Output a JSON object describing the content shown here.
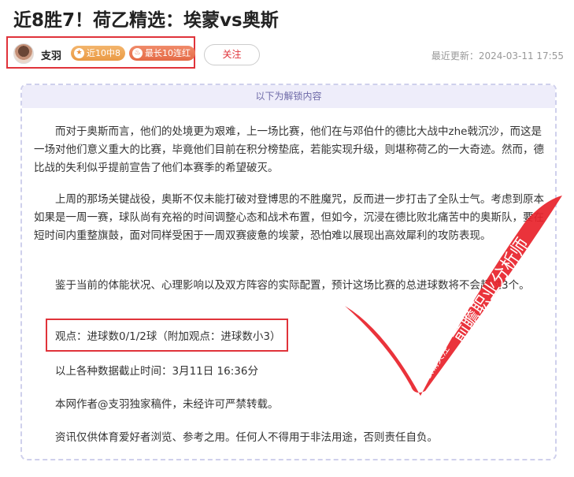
{
  "article": {
    "title": "近8胜7！荷乙精选：埃蒙vs奥斯",
    "author_name": "支羽",
    "badges": [
      {
        "icon": "star-icon",
        "label": "近10中8"
      },
      {
        "icon": "flame-icon",
        "label": "最长10连红"
      }
    ],
    "follow_label": "关注",
    "update_time": "最近更新：2024-03-11 17:55"
  },
  "content": {
    "unlock_banner": "以下为解锁内容",
    "paragraphs": [
      "而对于奥斯而言，他们的处境更为艰难，上一场比赛，他们在与邓伯什的德比大战中zhe戟沉沙，而这是一场对他们意义重大的比赛，毕竟他们目前在积分榜垫底，若能实现升级，则堪称荷乙的一大奇迹。然而，德比战的失利似乎提前宣告了他们本赛季的希望破灭。",
      "上周的那场关键战役，奥斯不仅未能打破对登博思的不胜魔咒，反而进一步打击了全队士气。考虑到原本如果是一周一赛，球队尚有充裕的时间调整心态和战术布置，但如今，沉浸在德比败北痛苦中的奥斯队，要在短时间内重整旗鼓，面对同样受困于一周双赛疲惫的埃蒙，恐怕难以展现出高效犀利的攻防表现。",
      "鉴于当前的体能状况、心理影响以及双方阵容的实际配置，预计这场比赛的总进球数将不会超过3个。"
    ],
    "opinion": "观点：进球数0/1/2球（附加观点：进球数小3）",
    "data_cutoff": "以上各种数据截止时间：3月11日 16:36分",
    "copyright": "本网作者@支羽独家稿件，未经许可严禁转载。",
    "disclaimer": "资讯仅供体育爱好者浏览、参考之用。任何人不得用于非法用途，否则责任自负。"
  },
  "watermark": {
    "main_text": "前瞻职业分析师",
    "sub_text": "敬请关注",
    "color": "#e8232c"
  },
  "colors": {
    "highlight_border": "#e0333a",
    "banner_bg": "#eeedfa",
    "banner_text": "#6e6aa8"
  }
}
